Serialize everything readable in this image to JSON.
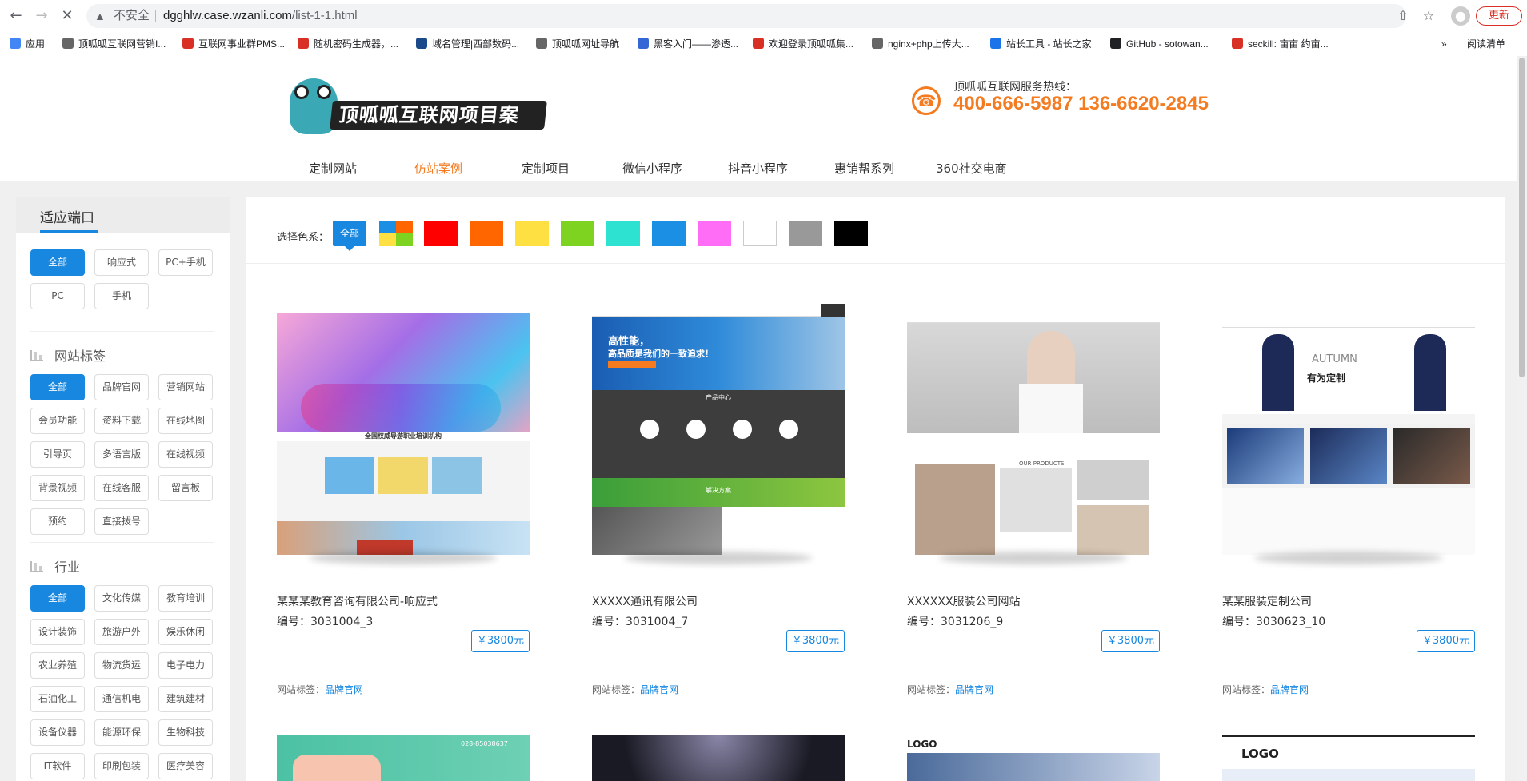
{
  "browser": {
    "insecure_label": "不安全",
    "url_host": "dgghlw.case.wzanli.com",
    "url_path": "/list-1-1.html",
    "update_label": "更新",
    "bookmarks": [
      {
        "label": "应用",
        "color": "#4285f4"
      },
      {
        "label": "顶呱呱互联网营销I...",
        "color": "#666666"
      },
      {
        "label": "互联网事业群PMS...",
        "color": "#d93025"
      },
      {
        "label": "随机密码生成器，...",
        "color": "#d93025"
      },
      {
        "label": "域名管理|西部数码...",
        "color": "#1a4a8a"
      },
      {
        "label": "顶呱呱网址导航",
        "color": "#666666"
      },
      {
        "label": "黑客入门——渗透...",
        "color": "#3367d6"
      },
      {
        "label": "欢迎登录顶呱呱集...",
        "color": "#d93025"
      },
      {
        "label": "nginx+php上传大...",
        "color": "#666666"
      },
      {
        "label": "站长工具 - 站长之家",
        "color": "#1a73e8"
      },
      {
        "label": "GitHub - sotowan...",
        "color": "#202124"
      },
      {
        "label": "seckill: 亩亩 约亩...",
        "color": "#d93025"
      }
    ],
    "reading_list": "阅读清单"
  },
  "header": {
    "logo_text": "顶呱呱互联网项目案例库",
    "hotline_label": "顶呱呱互联网服务热线：",
    "hotline_numbers": "400-666-5987 136-6620-2845"
  },
  "nav": {
    "items": [
      {
        "label": "定制网站"
      },
      {
        "label": "仿站案例",
        "active": true
      },
      {
        "label": "定制项目"
      },
      {
        "label": "微信小程序"
      },
      {
        "label": "抖音小程序"
      },
      {
        "label": "惠销帮系列"
      },
      {
        "label": "360社交电商"
      }
    ]
  },
  "sidebar": {
    "title": "适应端口",
    "ports": [
      "全部",
      "响应式",
      "PC+手机",
      "PC",
      "手机"
    ],
    "site_tags_title": "网站标签",
    "site_tags": [
      "全部",
      "品牌官网",
      "营销网站",
      "会员功能",
      "资料下载",
      "在线地图",
      "引导页",
      "多语言版",
      "在线视频",
      "背景视频",
      "在线客服",
      "留言板",
      "预约",
      "直接拨号"
    ],
    "industry_title": "行业",
    "industries": [
      "全部",
      "文化传媒",
      "教育培训",
      "设计装饰",
      "旅游户外",
      "娱乐休闲",
      "农业养殖",
      "物流货运",
      "电子电力",
      "石油化工",
      "通信机电",
      "建筑建材",
      "设备仪器",
      "能源环保",
      "生物科技",
      "IT软件",
      "印刷包装",
      "医疗美容"
    ]
  },
  "main": {
    "color_label": "选择色系：",
    "color_all": "全部",
    "colors": [
      "#ff0000",
      "#ff6600",
      "#ffe042",
      "#7ed321",
      "#2ee2d1",
      "#1a8fe3",
      "#ff6cf5",
      "#ffffff",
      "#999999",
      "#000000"
    ],
    "cards": [
      {
        "title": "某某某教育咨询有限公司-响应式",
        "number": "编号：3031004_3",
        "price": "￥3800元",
        "tag_label": "网站标签：",
        "tag": "品牌官网"
      },
      {
        "title": "XXXXX通讯有限公司",
        "number": "编号：3031004_7",
        "price": "￥3800元",
        "tag_label": "网站标签：",
        "tag": "品牌官网"
      },
      {
        "title": "XXXXXX服装公司网站",
        "number": "编号：3031206_9",
        "price": "￥3800元",
        "tag_label": "网站标签：",
        "tag": "品牌官网"
      },
      {
        "title": "某某服装定制公司",
        "number": "编号：3030623_10",
        "price": "￥3800元",
        "tag_label": "网站标签：",
        "tag": "品牌官网"
      }
    ],
    "thumb_texts": {
      "card1_banner": "全国权威导游职业培训机构",
      "card2_banner1": "高性能，",
      "card2_banner2": "高品质是我们的一致追求！",
      "card2_section": "产品中心",
      "card2_solution": "解决方案",
      "card3_products": "OUR PRODUCTS",
      "card4_autumn": "AUTUMN",
      "card4_slogan": "有为定制",
      "bottom_logo": "LOGO",
      "bottom_phone": "028-85038637"
    }
  }
}
